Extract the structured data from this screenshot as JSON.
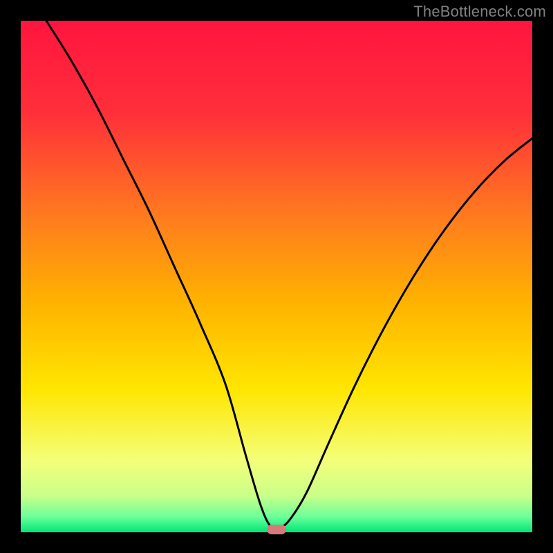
{
  "attribution": "TheBottleneck.com",
  "chart_data": {
    "type": "line",
    "title": "",
    "xlabel": "",
    "ylabel": "",
    "xlim": [
      0,
      100
    ],
    "ylim": [
      0,
      100
    ],
    "background_gradient": [
      "#ff1744",
      "#ff8a00",
      "#ffe600",
      "#f6ff8a",
      "#00e676"
    ],
    "curve": {
      "name": "bottleneck-curve",
      "x": [
        5,
        10,
        15,
        20,
        25,
        30,
        35,
        40,
        44,
        47,
        49,
        51,
        53,
        56,
        60,
        65,
        70,
        75,
        80,
        85,
        90,
        95,
        100
      ],
      "y": [
        100,
        92,
        83,
        73,
        63,
        52,
        41,
        29,
        15,
        5,
        1,
        1,
        3,
        8,
        17,
        28,
        38,
        47,
        55,
        62,
        68,
        73,
        77
      ]
    },
    "marker": {
      "name": "optimal-point",
      "x": 50,
      "y": 0,
      "color": "#d67a7a",
      "shape": "pill"
    }
  }
}
